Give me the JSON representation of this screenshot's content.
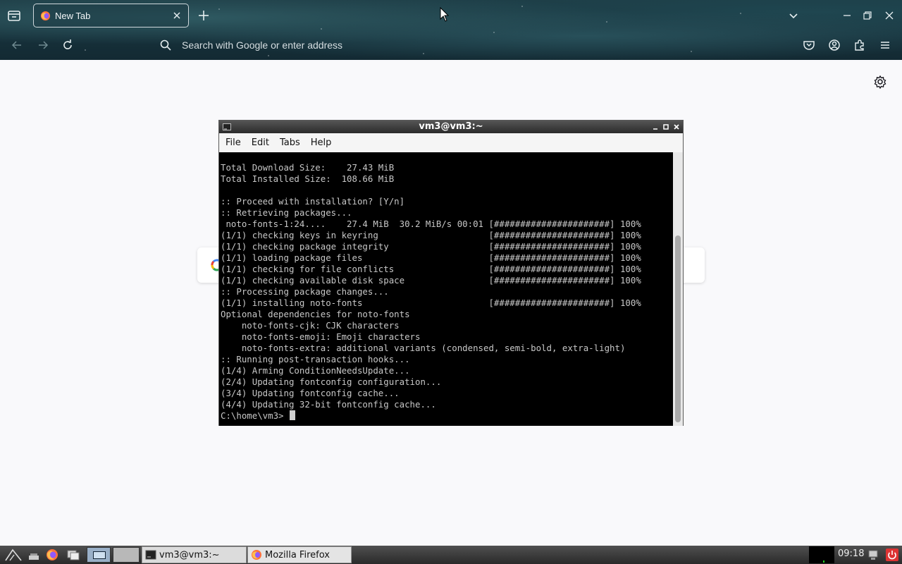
{
  "browser": {
    "tab_title": "New Tab",
    "url_placeholder": "Search with Google or enter address"
  },
  "terminal": {
    "title": "vm3@vm3:~",
    "menu": [
      "File",
      "Edit",
      "Tabs",
      "Help"
    ],
    "lines": [
      "Total Download Size:    27.43 MiB",
      "Total Installed Size:  108.66 MiB",
      "",
      ":: Proceed with installation? [Y/n]",
      ":: Retrieving packages...",
      " noto-fonts-1:24....    27.4 MiB  30.2 MiB/s 00:01 [######################] 100%",
      "(1/1) checking keys in keyring                     [######################] 100%",
      "(1/1) checking package integrity                   [######################] 100%",
      "(1/1) loading package files                        [######################] 100%",
      "(1/1) checking for file conflicts                  [######################] 100%",
      "(1/1) checking available disk space                [######################] 100%",
      ":: Processing package changes...",
      "(1/1) installing noto-fonts                        [######################] 100%",
      "Optional dependencies for noto-fonts",
      "    noto-fonts-cjk: CJK characters",
      "    noto-fonts-emoji: Emoji characters",
      "    noto-fonts-extra: additional variants (condensed, semi-bold, extra-light)",
      ":: Running post-transaction hooks...",
      "(1/4) Arming ConditionNeedsUpdate...",
      "(2/4) Updating fontconfig configuration...",
      "(3/4) Updating fontconfig cache...",
      "(4/4) Updating 32-bit fontconfig cache..."
    ],
    "prompt": "C:\\home\\vm3> "
  },
  "taskbar": {
    "tasks": [
      {
        "label": "vm3@vm3:~"
      },
      {
        "label": "Mozilla Firefox"
      }
    ],
    "clock": "09:18"
  },
  "colors": {
    "terminal_bg": "#000000",
    "terminal_fg": "#c7c7c7",
    "browser_bg": "#f9f9fb"
  }
}
